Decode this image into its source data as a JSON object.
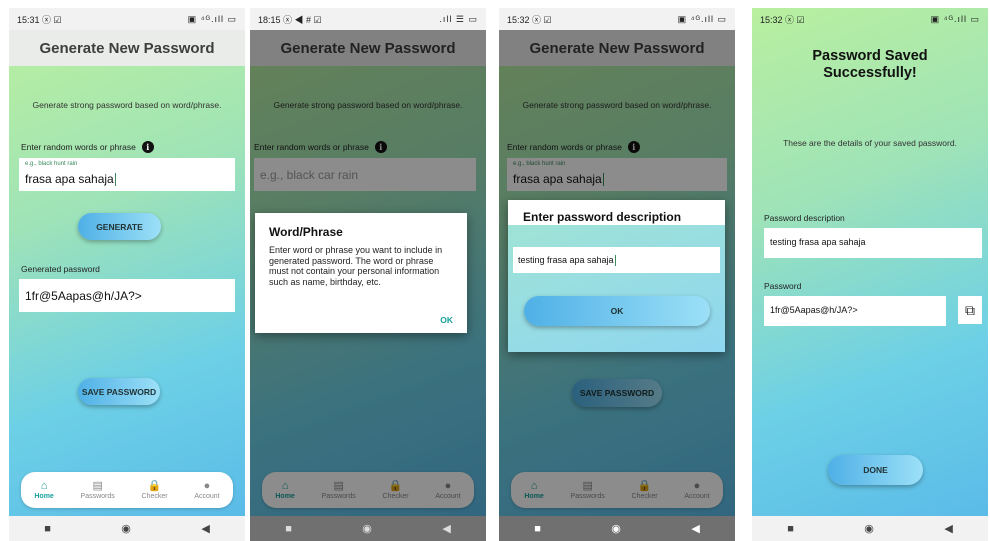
{
  "status": {
    "s1_time": "15:31 ⓧ ☑",
    "s2_time": "18:15 ⓧ ◀ # ☑",
    "s3_time": "15:32 ⓧ ☑",
    "s4_time": "15:32 ⓧ ☑",
    "right_icons": "▣ ⁴ᴳ.ıll ▭",
    "right_icons_wifi": ".ıll ☰ ▭"
  },
  "gen": {
    "title": "Generate New Password",
    "description": "Generate strong password based on word/phrase.",
    "phrase_label": "Enter random words or phrase",
    "info_icon": "i",
    "phrase_hint": "e.g., black hunt rain",
    "phrase_value": "frasa apa sahaja",
    "phrase_placeholder": "e.g., black car rain",
    "generate_label": "GENERATE",
    "generated_label": "Generated password",
    "generated_value": "1fr@5Aapas@h/JA?>",
    "save_label": "SAVE PASSWORD"
  },
  "nav": {
    "home": "Home",
    "passwords": "Passwords",
    "checker": "Checker",
    "account": "Account",
    "icons": {
      "home": "⌂",
      "passwords": "▤",
      "checker": "🔒",
      "account": "●"
    }
  },
  "sysnav": {
    "recents": "■",
    "home": "◉",
    "back": "◀"
  },
  "phrase_dialog": {
    "title": "Word/Phrase",
    "body": "Enter word or phrase you want to include in generated password. The word or phrase must not contain your personal information such as name, birthday, etc.",
    "ok": "OK"
  },
  "desc_dialog": {
    "title": "Enter password description",
    "value": "testing frasa apa sahaja",
    "ok": "OK"
  },
  "saved": {
    "title": "Password Saved Successfully!",
    "subtitle": "These are the details of your saved password.",
    "desc_label": "Password description",
    "desc_value": "testing frasa apa sahaja",
    "pw_label": "Password",
    "pw_value": "1fr@5Aapas@h/JA?>",
    "copy_icon": "⧉",
    "done": "DONE"
  }
}
